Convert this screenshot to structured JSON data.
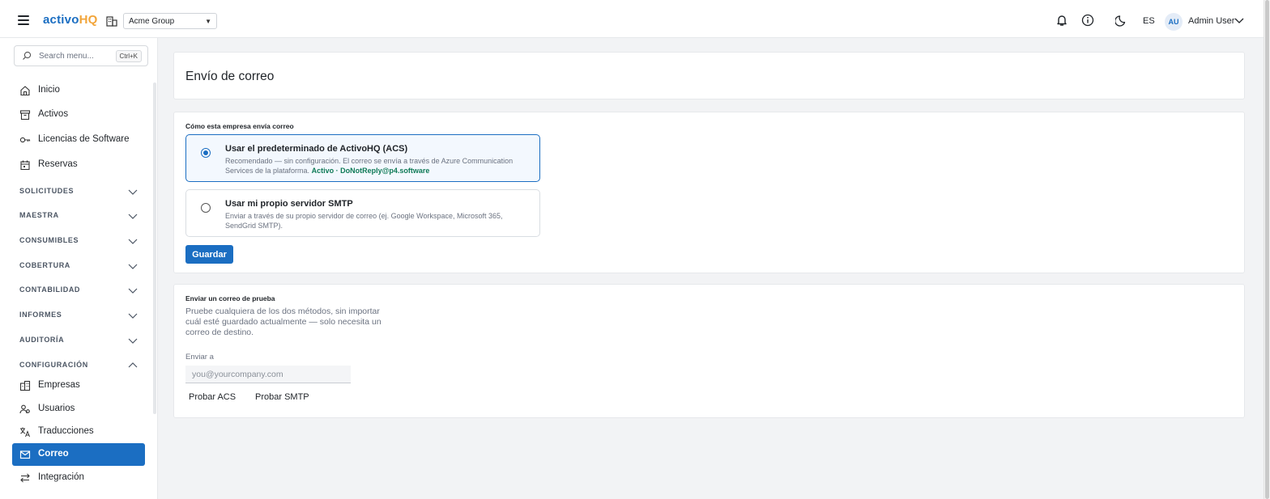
{
  "app": {
    "logo_part1": "activo",
    "logo_part2": "HQ",
    "organization": "Acme Group",
    "language": "ES",
    "user_initials": "AU",
    "user_name": "Admin User"
  },
  "colors": {
    "accent": "#1b6ec2",
    "logo_accent": "#f2a53a",
    "status_ok": "#0f7a57"
  },
  "icons": {
    "menu": "hamburger-icon",
    "org": "building-icon",
    "notifications": "bell-icon",
    "info": "info-icon",
    "theme": "moon-icon",
    "search": "search-icon",
    "home": "home-icon",
    "assets": "box-icon",
    "licenses": "key-icon",
    "bookings": "calendar-icon",
    "companies": "buildings-icon",
    "users": "users-icon",
    "translations": "translate-icon",
    "mail": "mail-icon",
    "integration": "arrows-icon"
  },
  "sidebar": {
    "search_placeholder": "Search menu...",
    "search_shortcut": "Ctrl+K",
    "items": [
      {
        "label": "Inicio"
      },
      {
        "label": "Activos"
      },
      {
        "label": "Licencias de Software"
      },
      {
        "label": "Reservas"
      }
    ],
    "sections": [
      {
        "label": "SOLICITUDES",
        "expanded": false
      },
      {
        "label": "MAESTRA",
        "expanded": false
      },
      {
        "label": "CONSUMIBLES",
        "expanded": false
      },
      {
        "label": "COBERTURA",
        "expanded": false
      },
      {
        "label": "CONTABILIDAD",
        "expanded": false
      },
      {
        "label": "INFORMES",
        "expanded": false
      },
      {
        "label": "AUDITORÍA",
        "expanded": false
      },
      {
        "label": "CONFIGURACIÓN",
        "expanded": true
      }
    ],
    "config_items": [
      {
        "label": "Empresas"
      },
      {
        "label": "Usuarios"
      },
      {
        "label": "Traducciones"
      },
      {
        "label": "Correo",
        "active": true
      },
      {
        "label": "Integración"
      }
    ]
  },
  "main": {
    "title": "Envío de correo",
    "config": {
      "heading": "Cómo esta empresa envía correo",
      "option_acs": {
        "title": "Usar el predeterminado de ActivoHQ (ACS)",
        "description": "Recomendado — sin configuración. El correo se envía a través de Azure Communication Services de la plataforma.",
        "status": "Activo · DoNotReply@p4.software",
        "selected": true
      },
      "option_smtp": {
        "title": "Usar mi propio servidor SMTP",
        "description": "Enviar a través de su propio servidor de correo (ej. Google Workspace, Microsoft 365, SendGrid SMTP).",
        "selected": false
      },
      "save_label": "Guardar"
    },
    "test": {
      "heading": "Enviar un correo de prueba",
      "description": "Pruebe cualquiera de los dos métodos, sin importar cuál esté guardado actualmente — solo necesita un correo de destino.",
      "field_label": "Enviar a",
      "email_placeholder": "you@yourcompany.com",
      "email_value": "",
      "test_acs_label": "Probar ACS",
      "test_smtp_label": "Probar SMTP"
    }
  }
}
